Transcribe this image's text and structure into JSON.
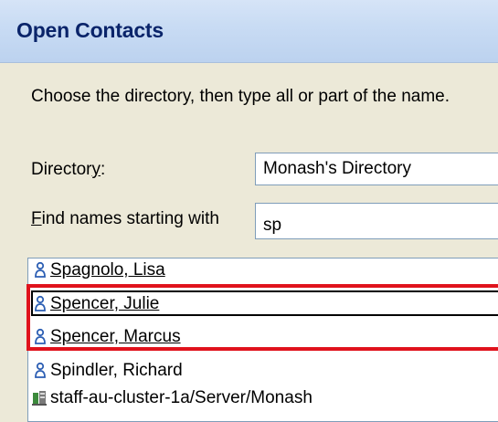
{
  "window": {
    "title": "Open Contacts"
  },
  "instructions": "Choose the directory, then type all or part of the name.",
  "directory": {
    "label_prefix": "Director",
    "label_mnemonic": "y",
    "label_suffix": ":",
    "value": "Monash's Directory"
  },
  "find": {
    "label_mnemonic": "F",
    "label_rest": "ind names starting with",
    "value": "sp"
  },
  "results": [
    {
      "name": "Spagnolo, Lisa",
      "icon": "person-icon"
    },
    {
      "name": "Spencer, Julie",
      "icon": "person-icon"
    },
    {
      "name": "Spencer, Marcus",
      "icon": "person-icon"
    },
    {
      "name": "Spindler, Richard",
      "icon": "person-icon"
    },
    {
      "name": "staff-au-cluster-1a/Server/Monash",
      "icon": "server-icon"
    }
  ],
  "colors": {
    "highlight_red": "#e0121c",
    "title_text": "#0a246a",
    "icon_blue": "#2d5fb4"
  }
}
